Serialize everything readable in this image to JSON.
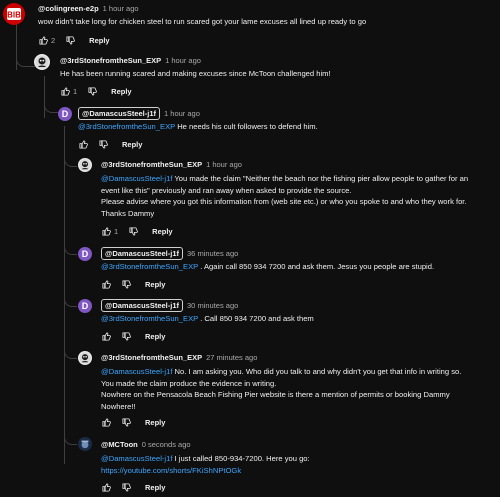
{
  "comments": [
    {
      "author": "@colingreen-e2p",
      "time": "1 hour ago",
      "body": "wow didn't take long for chicken steel to run scared got your lame excuses all lined up ready to go",
      "likes": "2",
      "reply_label": "Reply",
      "avatar_color": "#cc0000",
      "avatar_text": "BIB"
    },
    {
      "author": "@3rdStonefromtheSun_EXP",
      "time": "1 hour ago",
      "body": "He has been running scared and making excuses since McToon challenged him!",
      "likes": "1",
      "reply_label": "Reply"
    },
    {
      "author": "@DamascusSteel-j1f",
      "time": "1 hour ago",
      "mention": "@3rdStonefromtheSun_EXP",
      "body": "  He needs his cult followers to defend him.",
      "reply_label": "Reply",
      "avatar_color": "#7e57c2",
      "avatar_text": "D"
    },
    {
      "author": "@3rdStonefromtheSun_EXP",
      "time": "1 hour ago",
      "mention": "@DamascusSteel-j1f",
      "body_line1": " You made the claim \"Neither the beach nor the fishing pier allow people to gather for an",
      "body_line2": "event like this\" previously and ran away when asked to provide the source.",
      "body_line3": "Please advise where you got this information from (web site etc.) or  who you spoke to and who they work for.",
      "body_line4": "Thanks Dammy",
      "likes": "1",
      "reply_label": "Reply"
    },
    {
      "author": "@DamascusSteel-j1f",
      "time": "36 minutes ago",
      "mention": "@3rdStonefromtheSun_EXP",
      "body": " .  Again call 850 934 7200 and ask them. Jesus you people are stupid.",
      "reply_label": "Reply",
      "avatar_color": "#7e57c2",
      "avatar_text": "D"
    },
    {
      "author": "@DamascusSteel-j1f",
      "time": "30 minutes ago",
      "mention": "@3rdStonefromtheSun_EXP",
      "body": " .  Call 850 934 7200 and ask them",
      "reply_label": "Reply",
      "avatar_color": "#7e57c2",
      "avatar_text": "D"
    },
    {
      "author": "@3rdStonefromtheSun_EXP",
      "time": "27 minutes ago",
      "mention": "@DamascusSteel-j1f",
      "body_line1": " No. I am asking you. Who did you talk to and why didn't you get that info in writing so.",
      "body_line2": "You made the claim produce the evidence in writing.",
      "body_line3": "Nowhere on the Pensacola Beach Fishing Pier website is there a mention of permits or booking Dammy",
      "body_line4": "Nowhere!!",
      "reply_label": "Reply"
    },
    {
      "author": "@MCToon",
      "time": "0 seconds ago",
      "mention": "@DamascusSteel-j1f",
      "body": "  I just called 850-934-7200.  Here you go:",
      "link": "https://youtube.com/shorts/FKiShNPtOGk",
      "reply_label": "Reply"
    }
  ],
  "icons": {
    "like": "thumbs-up-icon",
    "dislike": "thumbs-down-icon"
  },
  "colors": {
    "background": "#0f0f0f",
    "link": "#3ea6ff",
    "text": "#f1f1f1",
    "muted": "#aaaaaa"
  }
}
